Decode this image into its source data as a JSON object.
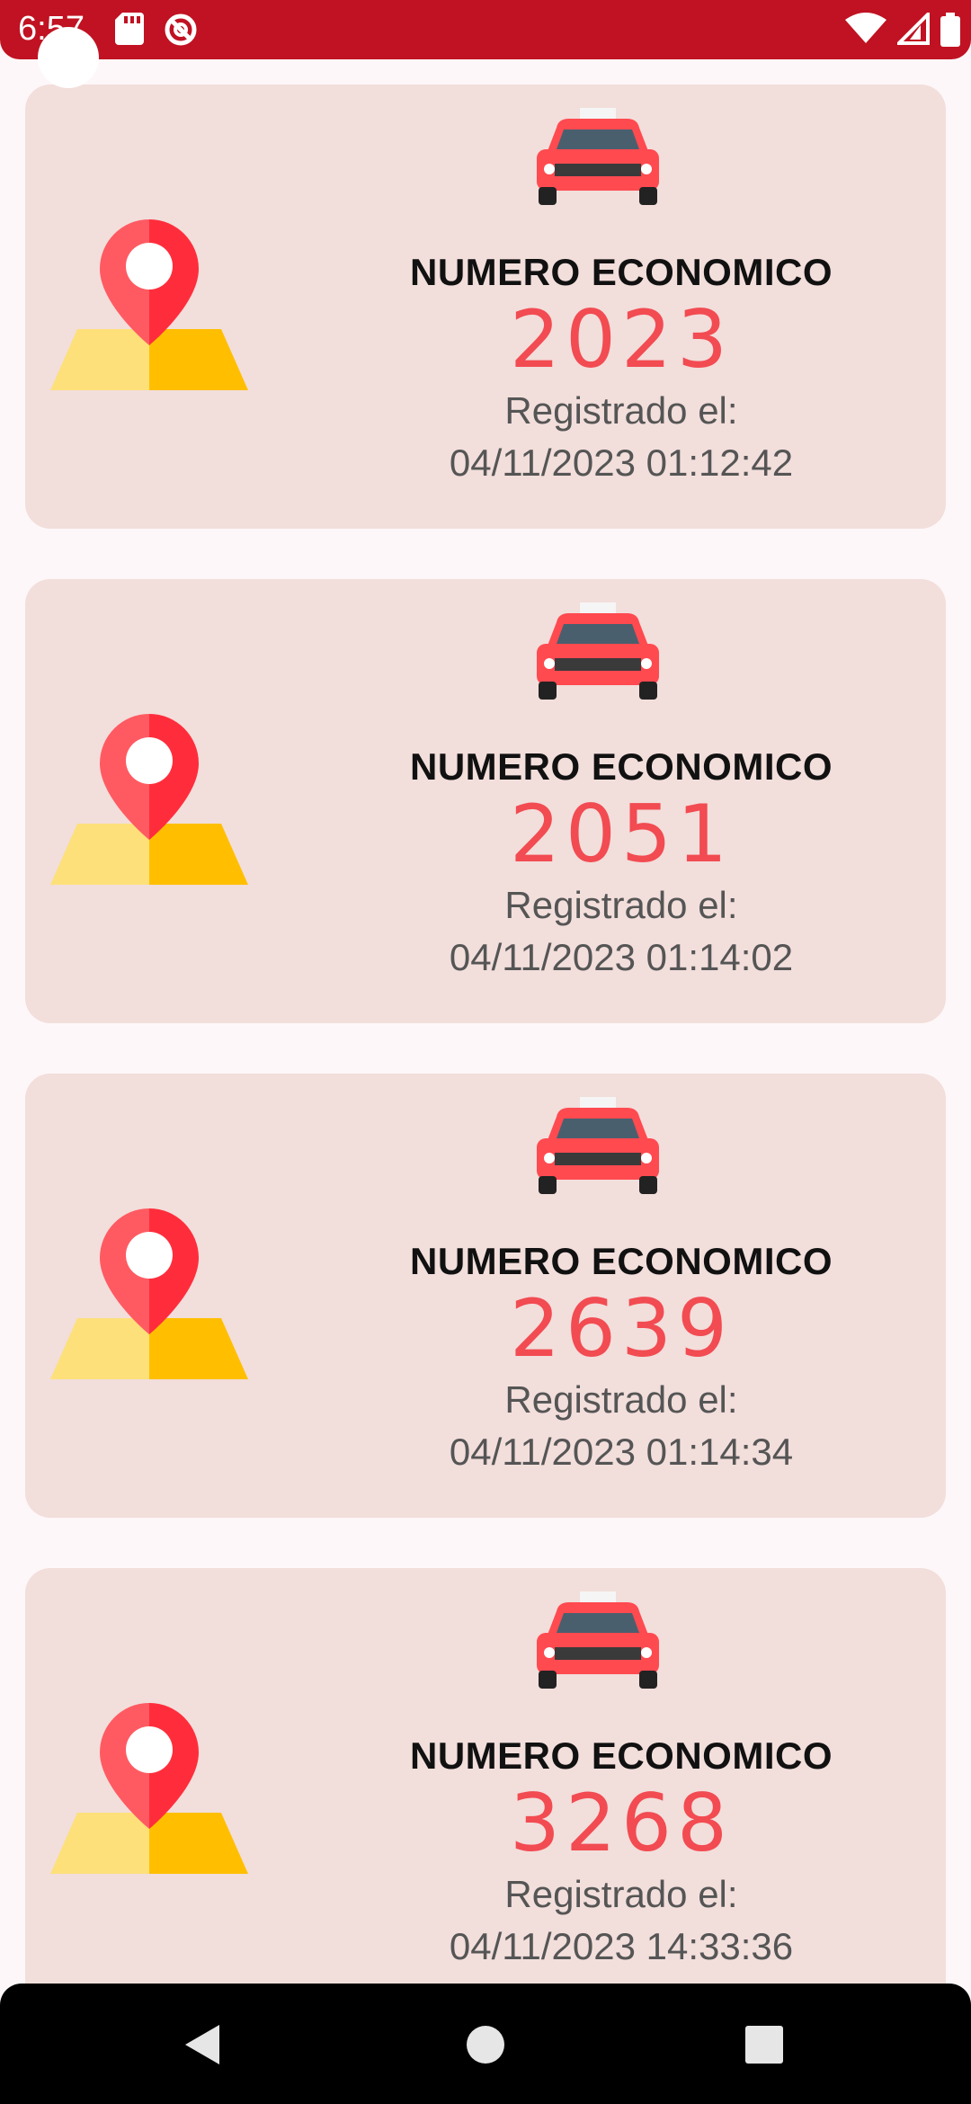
{
  "status_bar": {
    "time": "6:57",
    "left_icons": [
      "sd-card-icon",
      "no-disturb-icon"
    ],
    "right_icons": [
      "wifi-icon",
      "signal-icon",
      "battery-icon"
    ],
    "color": "#c01222"
  },
  "cards": [
    {
      "label": "NUMERO ECONOMICO",
      "number": "2023",
      "registered_label": "Registrado el:",
      "registered_date": "04/11/2023 01:12:42"
    },
    {
      "label": "NUMERO ECONOMICO",
      "number": "2051",
      "registered_label": "Registrado el:",
      "registered_date": "04/11/2023 01:14:02"
    },
    {
      "label": "NUMERO ECONOMICO",
      "number": "2639",
      "registered_label": "Registrado el:",
      "registered_date": "04/11/2023 01:14:34"
    },
    {
      "label": "NUMERO ECONOMICO",
      "number": "3268",
      "registered_label": "Registrado el:",
      "registered_date": "04/11/2023 14:33:36"
    }
  ],
  "icons": {
    "map": "map-pin-icon",
    "taxi": "taxi-icon"
  },
  "colors": {
    "card_background": "#f2dedb",
    "number": "#f24b52",
    "nav_background": "#000000"
  },
  "nav_bar": {
    "buttons": [
      "back-icon",
      "home-icon",
      "recents-icon"
    ]
  }
}
